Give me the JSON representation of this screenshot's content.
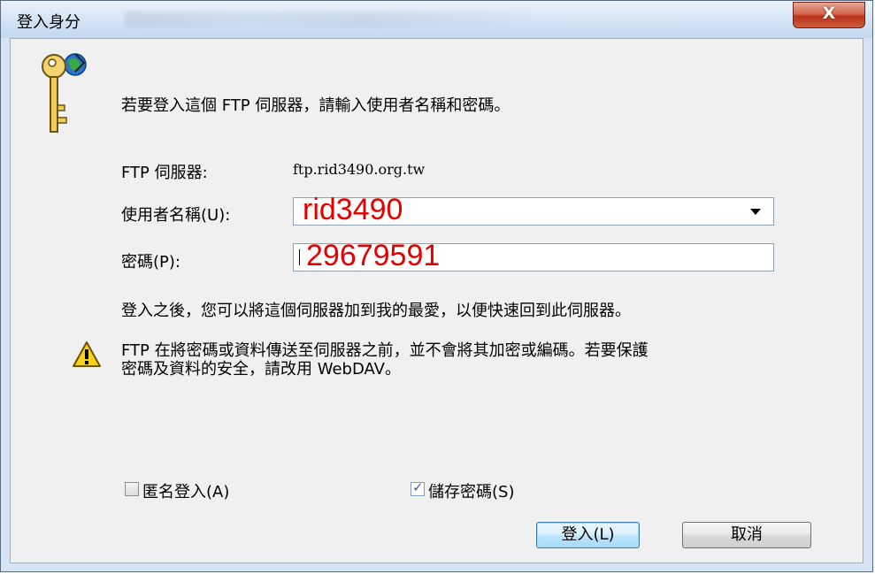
{
  "window": {
    "title": "登入身分",
    "close_label": "X"
  },
  "prompt": "若要登入這個 FTP 伺服器，請輸入使用者名稱和密碼。",
  "server": {
    "label": "FTP 伺服器:",
    "value": "ftp.rid3490.org.tw"
  },
  "username": {
    "label": "使用者名稱(U):",
    "value": "rid3490"
  },
  "password": {
    "label": "密碼(P):",
    "value": "29679591"
  },
  "info_text": "登入之後，您可以將這個伺服器加到我的最愛，以便快速回到此伺服器。",
  "warning": {
    "line1": "FTP 在將密碼或資料傳送至伺服器之前，並不會將其加密或編碼。若要保護",
    "line2": "密碼及資料的安全，請改用 WebDAV。"
  },
  "options": {
    "anonymous": {
      "label": "匿名登入(A)",
      "checked": false
    },
    "save_password": {
      "label": "儲存密碼(S)",
      "checked": true
    }
  },
  "buttons": {
    "login": "登入(L)",
    "cancel": "取消"
  },
  "colors": {
    "overlay_text": "#e30000",
    "default_button_border": "#3c7fb1"
  },
  "icons": {
    "dialog": "key-globe-icon",
    "warning": "warning-icon",
    "close": "close-icon",
    "dropdown": "chevron-down-icon",
    "check": "check-icon"
  }
}
